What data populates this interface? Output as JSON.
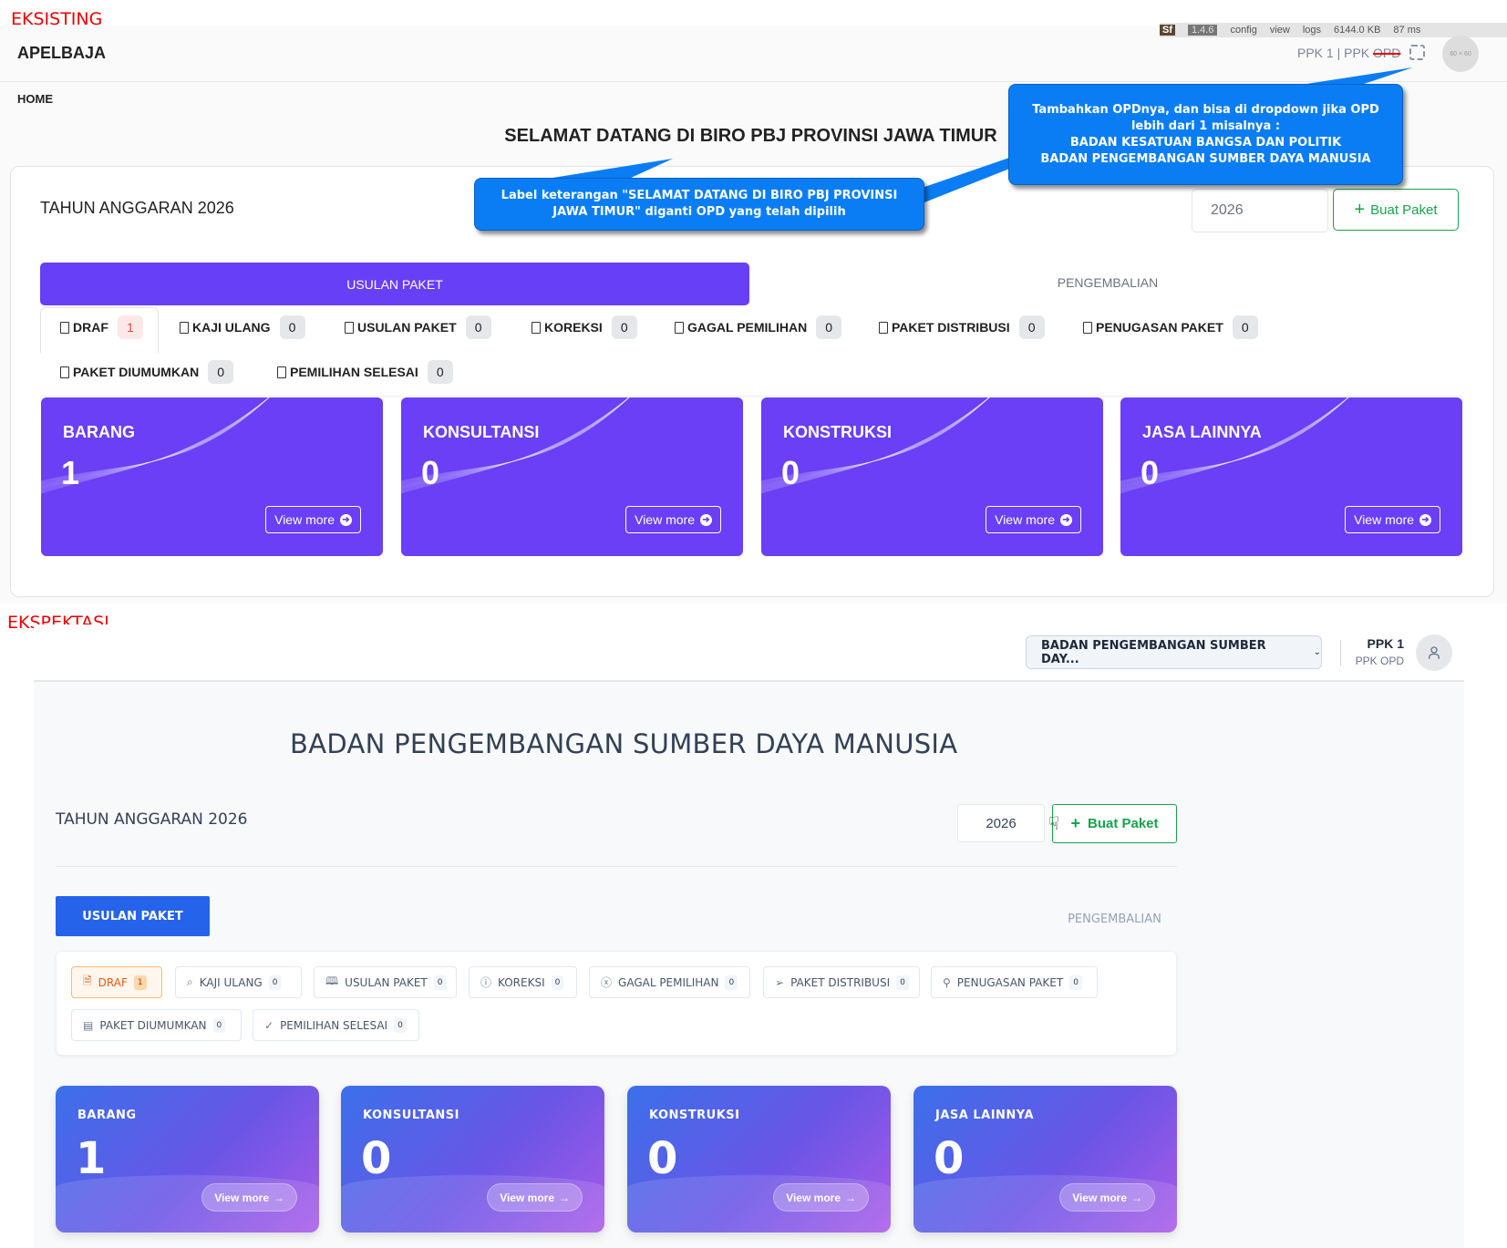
{
  "existing": {
    "section_label": "EKSISTING",
    "debugbar": {
      "logo": "Sf",
      "version": "1.4.6",
      "items": [
        "config",
        "view",
        "logs",
        "6144.0 KB",
        "87 ms"
      ]
    },
    "brand": "APELBAJA",
    "user": {
      "name": "PPK 1",
      "separator": "|",
      "role_prefix": "PPK",
      "role_struck": "OPD",
      "avatar_placeholder": "60 × 60"
    },
    "breadcrumb": "HOME",
    "welcome_title": "SELAMAT DATANG DI BIRO PBJ PROVINSI JAWA TIMUR",
    "fiscal_year_label": "TAHUN ANGGARAN 2026",
    "year_value": "2026",
    "create_button": "Buat Paket",
    "main_tabs": [
      "USULAN PAKET",
      "PENGEMBALIAN"
    ],
    "sub_tabs": [
      {
        "label": "DRAF",
        "count": "1"
      },
      {
        "label": "KAJI ULANG",
        "count": "0"
      },
      {
        "label": "USULAN PAKET",
        "count": "0"
      },
      {
        "label": "KOREKSI",
        "count": "0"
      },
      {
        "label": "GAGAL PEMILIHAN",
        "count": "0"
      },
      {
        "label": "PAKET DISTRIBUSI",
        "count": "0"
      },
      {
        "label": "PENUGASAN PAKET",
        "count": "0"
      },
      {
        "label": "PAKET DIUMUMKAN",
        "count": "0"
      },
      {
        "label": "PEMILIHAN SELESAI",
        "count": "0"
      }
    ],
    "cards": [
      {
        "title": "BARANG",
        "count": "1",
        "action": "View more"
      },
      {
        "title": "KONSULTANSI",
        "count": "0",
        "action": "View more"
      },
      {
        "title": "KONSTRUKSI",
        "count": "0",
        "action": "View more"
      },
      {
        "title": "JASA LAINNYA",
        "count": "0",
        "action": "View more"
      }
    ],
    "colors": {
      "primary": "#673ff7",
      "success": "#16a34a",
      "callout": "#0a7df4"
    }
  },
  "annotations": [
    {
      "lines": [
        "Label keterangan \"SELAMAT DATANG DI BIRO PBJ PROVINSI",
        "JAWA TIMUR\" diganti OPD yang telah dipilih"
      ]
    },
    {
      "lines": [
        "Tambahkan OPDnya, dan bisa di dropdown jika OPD",
        "lebih dari 1 misalnya :",
        "BADAN KESATUAN BANGSA DAN POLITIK",
        "BADAN PENGEMBANGAN SUMBER DAYA MANUSIA"
      ]
    }
  ],
  "expected": {
    "section_label": "EKSPEKTASI",
    "opd_dropdown": "BADAN PENGEMBANGAN SUMBER DAY...",
    "user": {
      "name": "PPK 1",
      "role": "PPK OPD"
    },
    "title": "BADAN PENGEMBANGAN SUMBER DAYA MANUSIA",
    "fiscal_year_label": "TAHUN ANGGARAN 2026",
    "year_value": "2026",
    "create_button": "Buat Paket",
    "main_tabs": [
      "USULAN PAKET",
      "PENGEMBALIAN"
    ],
    "sub_tabs": [
      {
        "label": "DRAF",
        "count": "1",
        "icon": "file-icon"
      },
      {
        "label": "KAJI ULANG",
        "count": "0",
        "icon": "search-icon"
      },
      {
        "label": "USULAN PAKET",
        "count": "0",
        "icon": "book-icon"
      },
      {
        "label": "KOREKSI",
        "count": "0",
        "icon": "alert-circle-icon"
      },
      {
        "label": "GAGAL PEMILIHAN",
        "count": "0",
        "icon": "x-circle-icon"
      },
      {
        "label": "PAKET DISTRIBUSI",
        "count": "0",
        "icon": "send-icon"
      },
      {
        "label": "PENUGASAN PAKET",
        "count": "0",
        "icon": "user-icon"
      },
      {
        "label": "PAKET DIUMUMKAN",
        "count": "0",
        "icon": "layout-icon"
      },
      {
        "label": "PEMILIHAN SELESAI",
        "count": "0",
        "icon": "check-circle-icon"
      }
    ],
    "cards": [
      {
        "title": "BARANG",
        "count": "1",
        "action": "View more"
      },
      {
        "title": "KONSULTANSI",
        "count": "0",
        "action": "View more"
      },
      {
        "title": "KONSTRUKSI",
        "count": "0",
        "action": "View more"
      },
      {
        "title": "JASA LAINNYA",
        "count": "0",
        "action": "View more"
      }
    ],
    "colors": {
      "primary": "#2563eb",
      "active_chip": "#ea580c",
      "success": "#16a34a"
    }
  }
}
